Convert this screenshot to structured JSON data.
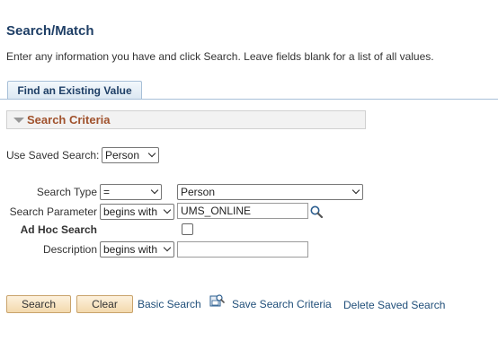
{
  "page": {
    "title": "Search/Match",
    "instructions": "Enter any information you have and click Search. Leave fields blank for a list of all values."
  },
  "tab": {
    "label": "Find an Existing Value"
  },
  "section": {
    "title": "Search Criteria"
  },
  "saved_search": {
    "label": "Use Saved Search:",
    "value": "Person"
  },
  "fields": {
    "search_type": {
      "label": "Search Type",
      "operator": "=",
      "value": "Person"
    },
    "search_parameter": {
      "label": "Search Parameter",
      "operator": "begins with",
      "value": "UMS_ONLINE"
    },
    "ad_hoc": {
      "label": "Ad Hoc Search",
      "checked": false
    },
    "description": {
      "label": "Description",
      "operator": "begins with",
      "value": ""
    }
  },
  "actions": {
    "search": "Search",
    "clear": "Clear",
    "basic_search": "Basic Search",
    "save_criteria": "Save Search Criteria",
    "delete_saved": "Delete Saved Search"
  },
  "icons": {
    "lookup": "magnifier-icon",
    "save": "save-criteria-icon",
    "collapse": "collapse-triangle-icon"
  }
}
